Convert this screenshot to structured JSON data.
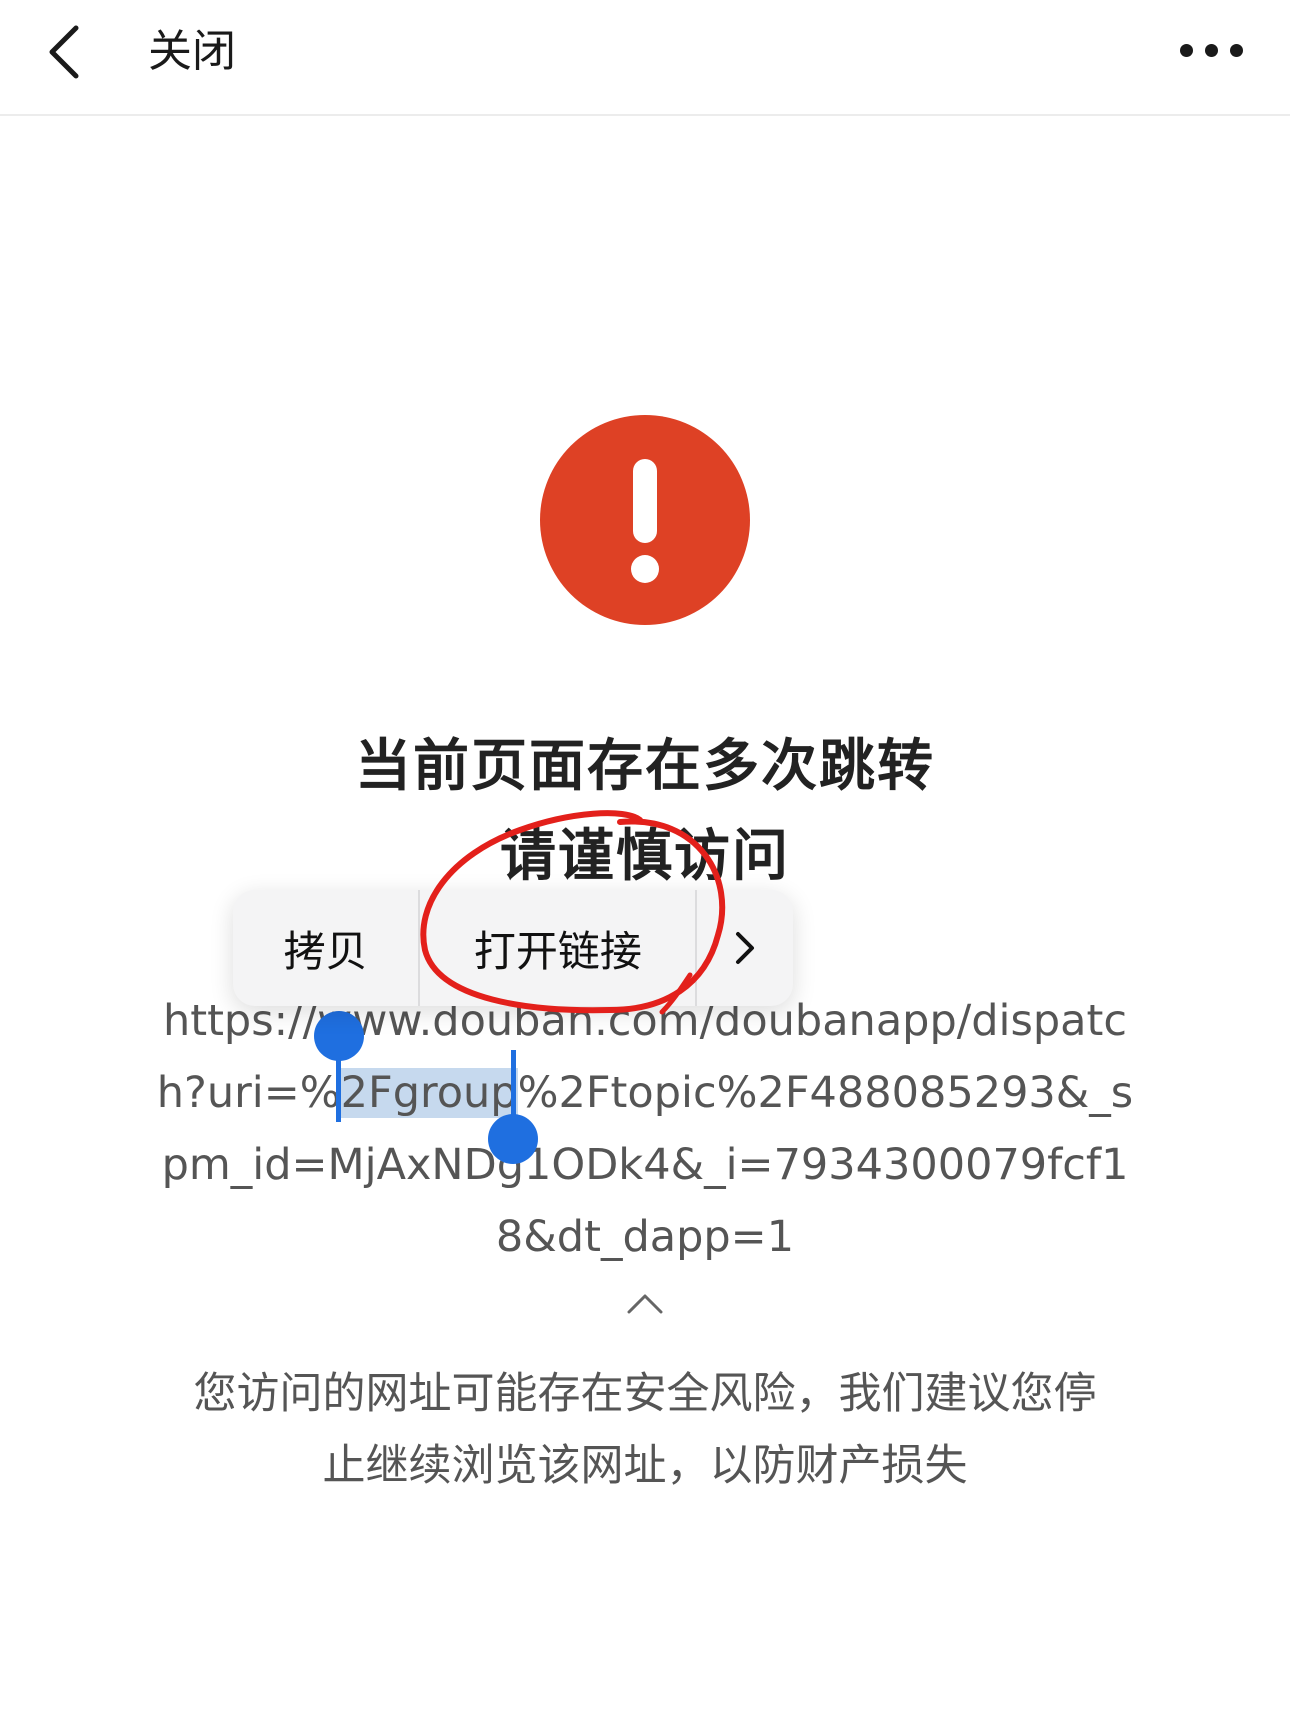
{
  "topbar": {
    "back_icon": "chevron-left-icon",
    "close_label": "关闭",
    "more_icon": "more-horizontal-icon"
  },
  "warning": {
    "icon": "exclamation-circle-icon",
    "icon_color": "#de4125",
    "headline_line1": "当前页面存在多次跳转",
    "headline_line2": "请谨慎访问"
  },
  "url": {
    "line1": "https://www.douban.com/doubanapp/dispatc",
    "line2_before": "h?uri=%",
    "line2_selected": "2Fgroup",
    "line2_after": "%2Ftopic%2F488085293&_s",
    "line3": "pm_id=MjAxNDg1ODk4&_i=7934300079fcf1",
    "line4": "8&dt_dapp=1",
    "collapse_icon": "chevron-up-icon"
  },
  "description": {
    "line1": "您访问的网址可能存在安全风险，我们建议您停",
    "line2": "止继续浏览该网址，以防财产损失"
  },
  "context_menu": {
    "copy_label": "拷贝",
    "open_link_label": "打开链接",
    "next_icon": "chevron-right-icon"
  },
  "colors": {
    "accent_selection": "#1f6fe0",
    "annotation_red": "#e3201b"
  }
}
